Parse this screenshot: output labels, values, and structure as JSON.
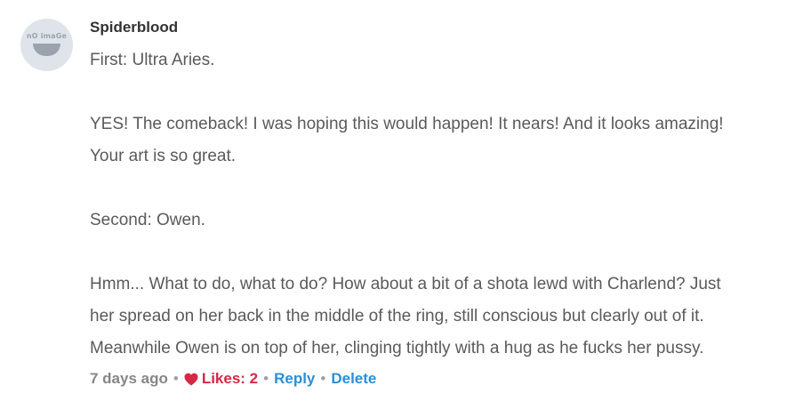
{
  "comment": {
    "avatar_text": "nO imaGe",
    "author": "Spiderblood",
    "paragraphs": [
      "First: Ultra Aries.",
      "YES! The comeback! I was hoping this would happen! It nears! And it looks amazing!",
      "Your art is so great.",
      "Second: Owen.",
      "Hmm... What to do, what to do? How about a bit of a shota lewd with Charlend? Just",
      "her spread on her back in the middle of the ring, still conscious but clearly out of it.",
      "Meanwhile Owen is on top of her, clinging tightly with a hug as he fucks her pussy."
    ],
    "timestamp": "7 days ago",
    "separator": "•",
    "likes_label": "Likes: 2",
    "reply_label": "Reply",
    "delete_label": "Delete",
    "colors": {
      "author": "#333333",
      "body_text": "#5a5a5a",
      "meta_text": "#868686",
      "likes": "#d42a45",
      "link": "#2a8fd8",
      "avatar_bg": "#dfe4ea"
    },
    "icons": {
      "likes": "heart-icon"
    }
  }
}
